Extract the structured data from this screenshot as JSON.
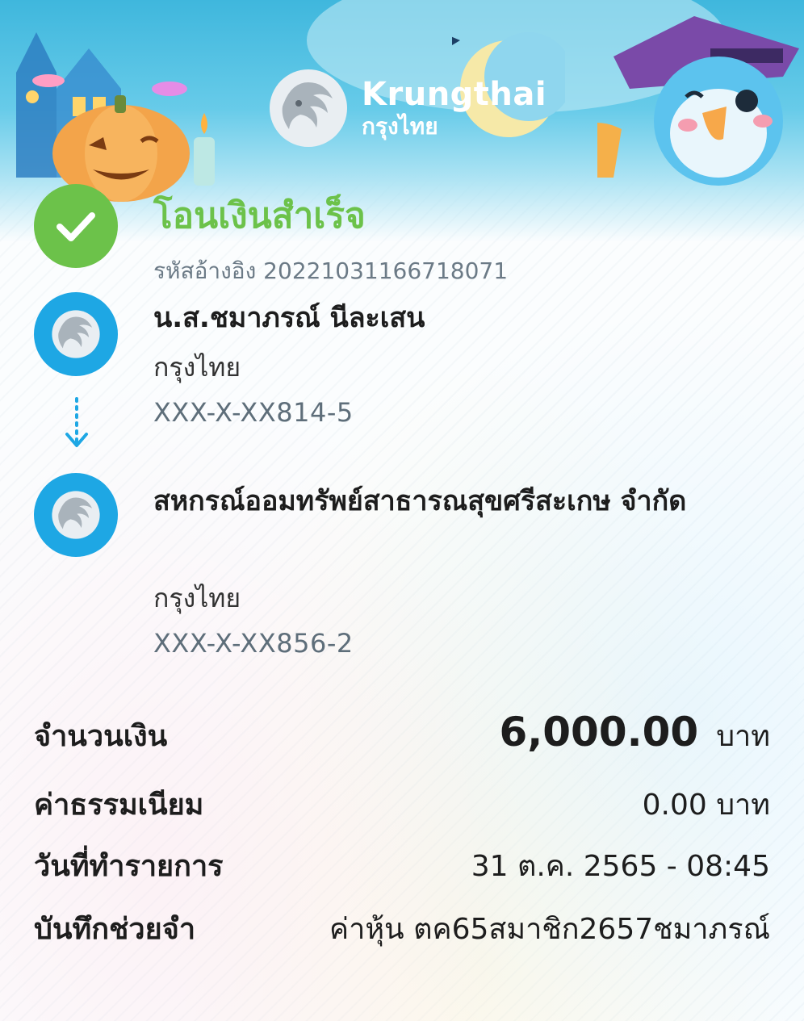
{
  "brand": {
    "name_en": "Krungthai",
    "name_th": "กรุงไทย"
  },
  "status": {
    "title": "โอนเงินสำเร็จ",
    "reference": "รหัสอ้างอิง 2022103116671807​1",
    "color": "#6cc24a"
  },
  "sender": {
    "name": "น.ส.ชมาภรณ์ นีละเสน",
    "bank": "กรุงไทย",
    "account": "XXX-X-XX814-5"
  },
  "receiver": {
    "name": "สหกรณ์ออมทรัพย์สาธารณสุขศรีสะเกษ จำกัด",
    "bank": "กรุงไทย",
    "account": "XXX-X-XX856-2"
  },
  "details": {
    "amount_label": "จำนวนเงิน",
    "amount_value": "6,000.00",
    "amount_unit": "บาท",
    "fee_label": "ค่าธรรมเนียม",
    "fee_value": "0.00 บาท",
    "date_label": "วันที่ทำรายการ",
    "date_value": "31 ต.ค. 2565 - 08:45",
    "note_label": "บันทึกช่วยจำ",
    "note_value": "ค่าหุ้น ตค65สมาชิก2657ชมาภรณ์"
  },
  "colors": {
    "accent_blue": "#1ea7e4",
    "success_green": "#6cc24a"
  }
}
